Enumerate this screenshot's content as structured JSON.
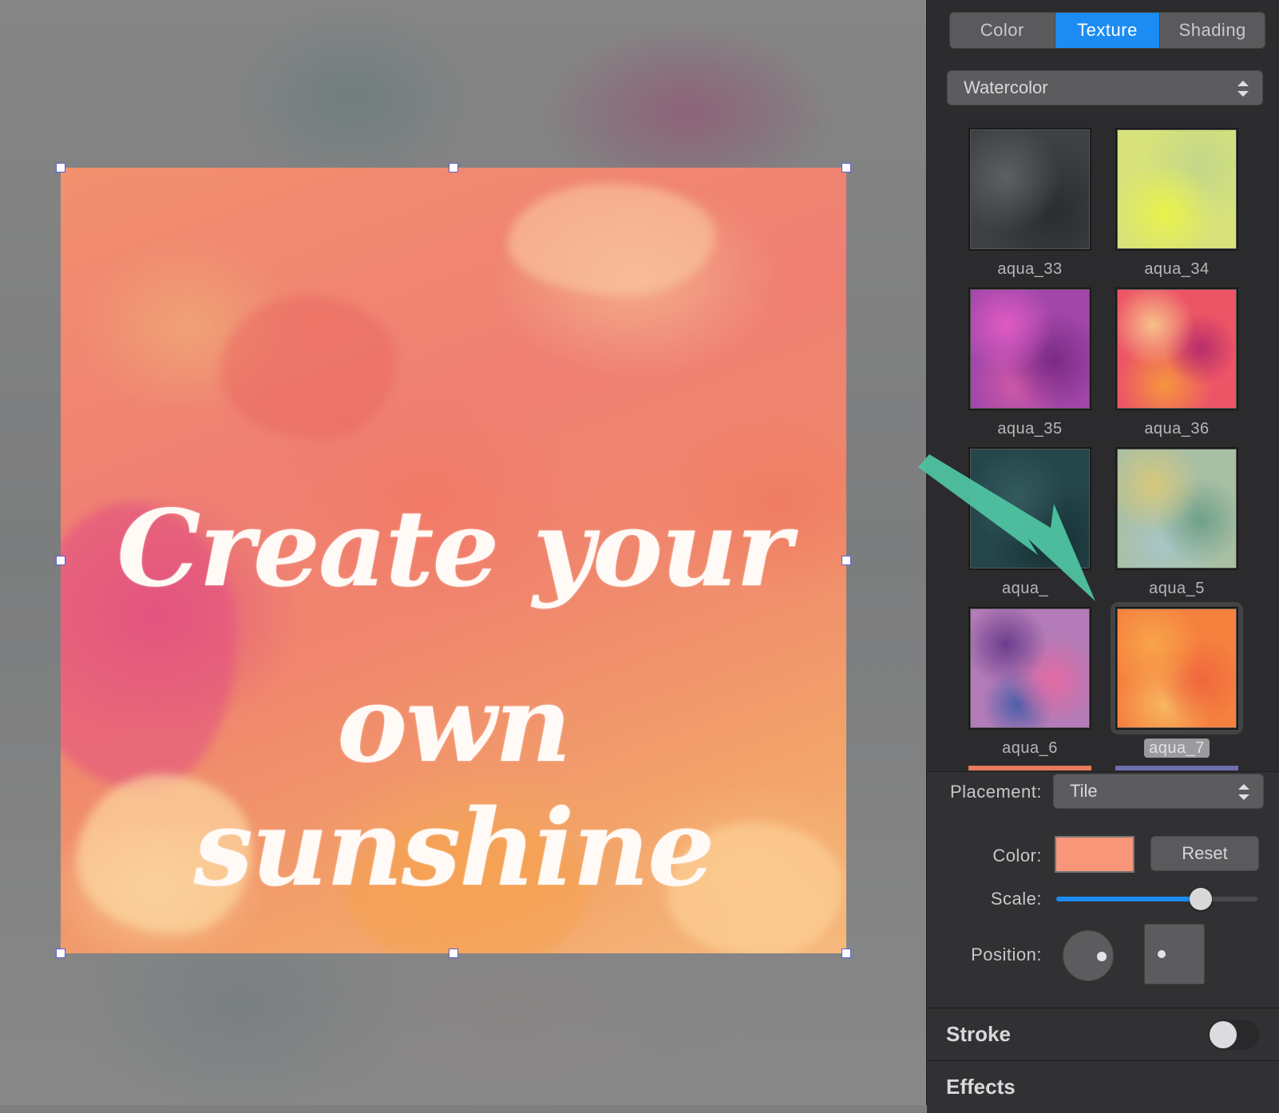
{
  "canvas": {
    "headline_line1": "Create your",
    "headline_line2": "own sunshine"
  },
  "tabs": [
    {
      "label": "Color",
      "active": false
    },
    {
      "label": "Texture",
      "active": true
    },
    {
      "label": "Shading",
      "active": false
    }
  ],
  "texture_category": {
    "selected": "Watercolor"
  },
  "textures": [
    {
      "label": "aqua_33"
    },
    {
      "label": "aqua_34"
    },
    {
      "label": "aqua_35"
    },
    {
      "label": "aqua_36"
    },
    {
      "label": "aqua_"
    },
    {
      "label": "aqua_5"
    },
    {
      "label": "aqua_6"
    },
    {
      "label": "aqua_7",
      "selected": true
    }
  ],
  "properties": {
    "placement_label": "Placement:",
    "placement_value": "Tile",
    "color_label": "Color:",
    "color_value": "#f99679",
    "reset_label": "Reset",
    "scale_label": "Scale:",
    "scale_fraction": 0.72,
    "position_label": "Position:"
  },
  "sections": {
    "stroke": "Stroke",
    "stroke_enabled": false,
    "effects": "Effects"
  },
  "colors": {
    "accent": "#1c8cf2",
    "annotation_arrow": "#4fc3a1"
  }
}
